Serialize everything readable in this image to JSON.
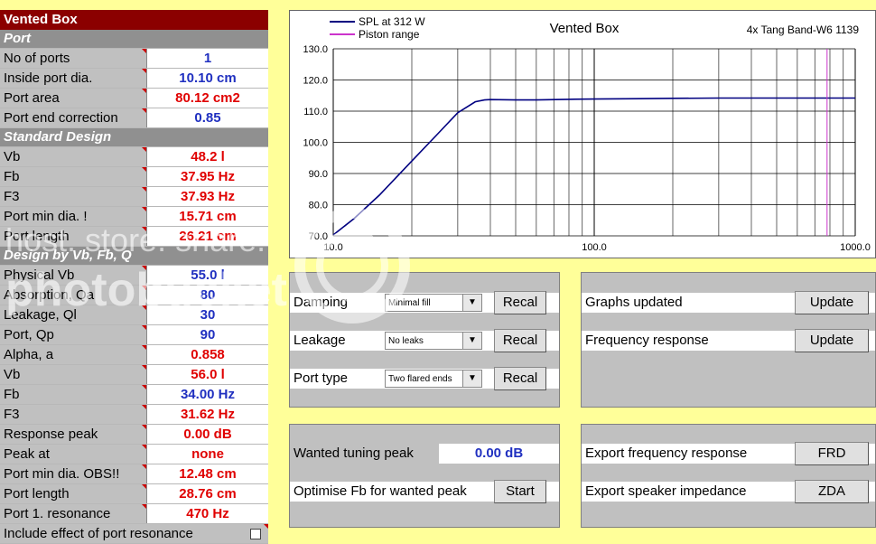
{
  "sheet": {
    "title": "Vented Box",
    "port_section": "Port",
    "standard_section": "Standard Design",
    "design_section": "Design by Vb, Fb, Q",
    "rows_port": [
      {
        "label": "No of ports",
        "value": "1",
        "color": "blue"
      },
      {
        "label": "Inside port dia.",
        "value": "10.10  cm",
        "color": "blue"
      },
      {
        "label": "Port area",
        "value": "80.12  cm2",
        "color": "red"
      },
      {
        "label": "Port end correction",
        "value": "0.85",
        "color": "blue"
      }
    ],
    "rows_standard": [
      {
        "label": "Vb",
        "value": "48.2  l",
        "color": "red"
      },
      {
        "label": "Fb",
        "value": "37.95  Hz",
        "color": "red"
      },
      {
        "label": "F3",
        "value": "37.93  Hz",
        "color": "red"
      },
      {
        "label": "Port min dia. !",
        "value": "15.71  cm",
        "color": "red"
      },
      {
        "label": "Port length",
        "value": "26.21  cm",
        "color": "red"
      }
    ],
    "rows_design": [
      {
        "label": "Physical Vb",
        "value": "55.0  l",
        "color": "blue"
      },
      {
        "label": "Absorption, Qa",
        "value": "80",
        "color": "blue"
      },
      {
        "label": "Leakage, Ql",
        "value": "30",
        "color": "blue"
      },
      {
        "label": "Port, Qp",
        "value": "90",
        "color": "blue"
      },
      {
        "label": "Alpha, a",
        "value": "0.858",
        "color": "red"
      },
      {
        "label": "Vb",
        "value": "56.0  l",
        "color": "red"
      },
      {
        "label": "Fb",
        "value": "34.00  Hz",
        "color": "blue"
      },
      {
        "label": "F3",
        "value": "31.62  Hz",
        "color": "red"
      },
      {
        "label": "Response peak",
        "value": "0.00  dB",
        "color": "red"
      },
      {
        "label": "Peak at",
        "value": "none",
        "color": "red"
      },
      {
        "label": "Port min dia. OBS!!",
        "value": "12.48  cm",
        "color": "red"
      },
      {
        "label": "Port length",
        "value": "28.76  cm",
        "color": "red"
      },
      {
        "label": "Port 1. resonance",
        "value": "470  Hz",
        "color": "red"
      }
    ],
    "include_label": "Include effect of port resonance"
  },
  "chart_data": {
    "type": "line",
    "title": "Vented Box",
    "subtitle": "4x Tang Band-W6 1139",
    "x_scale": "log",
    "xlim": [
      10,
      1000
    ],
    "ylim": [
      70,
      130
    ],
    "x_ticks": [
      "10.0",
      "100.0",
      "1000.0"
    ],
    "y_ticks": [
      "70.0",
      "80.0",
      "90.0",
      "100.0",
      "110.0",
      "120.0",
      "130.0"
    ],
    "grid": true,
    "legend_position": "top-left",
    "series": [
      {
        "name": "SPL at 312 W",
        "color": "#000080",
        "x": [
          10,
          12,
          15,
          20,
          25,
          30,
          35,
          38,
          40,
          50,
          60,
          80,
          100,
          150,
          200,
          300,
          500,
          700,
          1000
        ],
        "y": [
          70.3,
          75.5,
          83,
          94,
          102.5,
          109.5,
          113,
          113.6,
          113.7,
          113.6,
          113.6,
          113.8,
          113.9,
          114.0,
          114.1,
          114.2,
          114.2,
          114.2,
          114.2
        ]
      },
      {
        "name": "Piston range",
        "color": "#cc33cc",
        "x": [
          780,
          780
        ],
        "y": [
          70,
          130
        ]
      }
    ]
  },
  "controls": {
    "damping": {
      "label": "Damping",
      "selected": "Minimal fill",
      "button": "Recal"
    },
    "leakage": {
      "label": "Leakage",
      "selected": "No leaks",
      "button": "Recal"
    },
    "port_type": {
      "label": "Port type",
      "selected": "Two flared ends",
      "button": "Recal"
    },
    "graphs_updated": {
      "label": "Graphs updated",
      "button": "Update"
    },
    "frequency_response": {
      "label": "Frequency response",
      "button": "Update"
    },
    "tuning_peak": {
      "label": "Wanted tuning peak",
      "value": "0.00  dB"
    },
    "optimise": {
      "label": "Optimise Fb for wanted peak",
      "button": "Start"
    },
    "export_freq": {
      "label": "Export frequency response",
      "button": "FRD"
    },
    "export_imp": {
      "label": "Export speaker impedance",
      "button": "ZDA"
    }
  },
  "watermark": {
    "text": "host. store. share.",
    "brand": "photobucket"
  },
  "colors": {
    "header": "#8b0000",
    "label_bg": "#c0c0c0",
    "page_bg": "#ffff99",
    "red": "#e00000",
    "blue": "#2030c0"
  }
}
